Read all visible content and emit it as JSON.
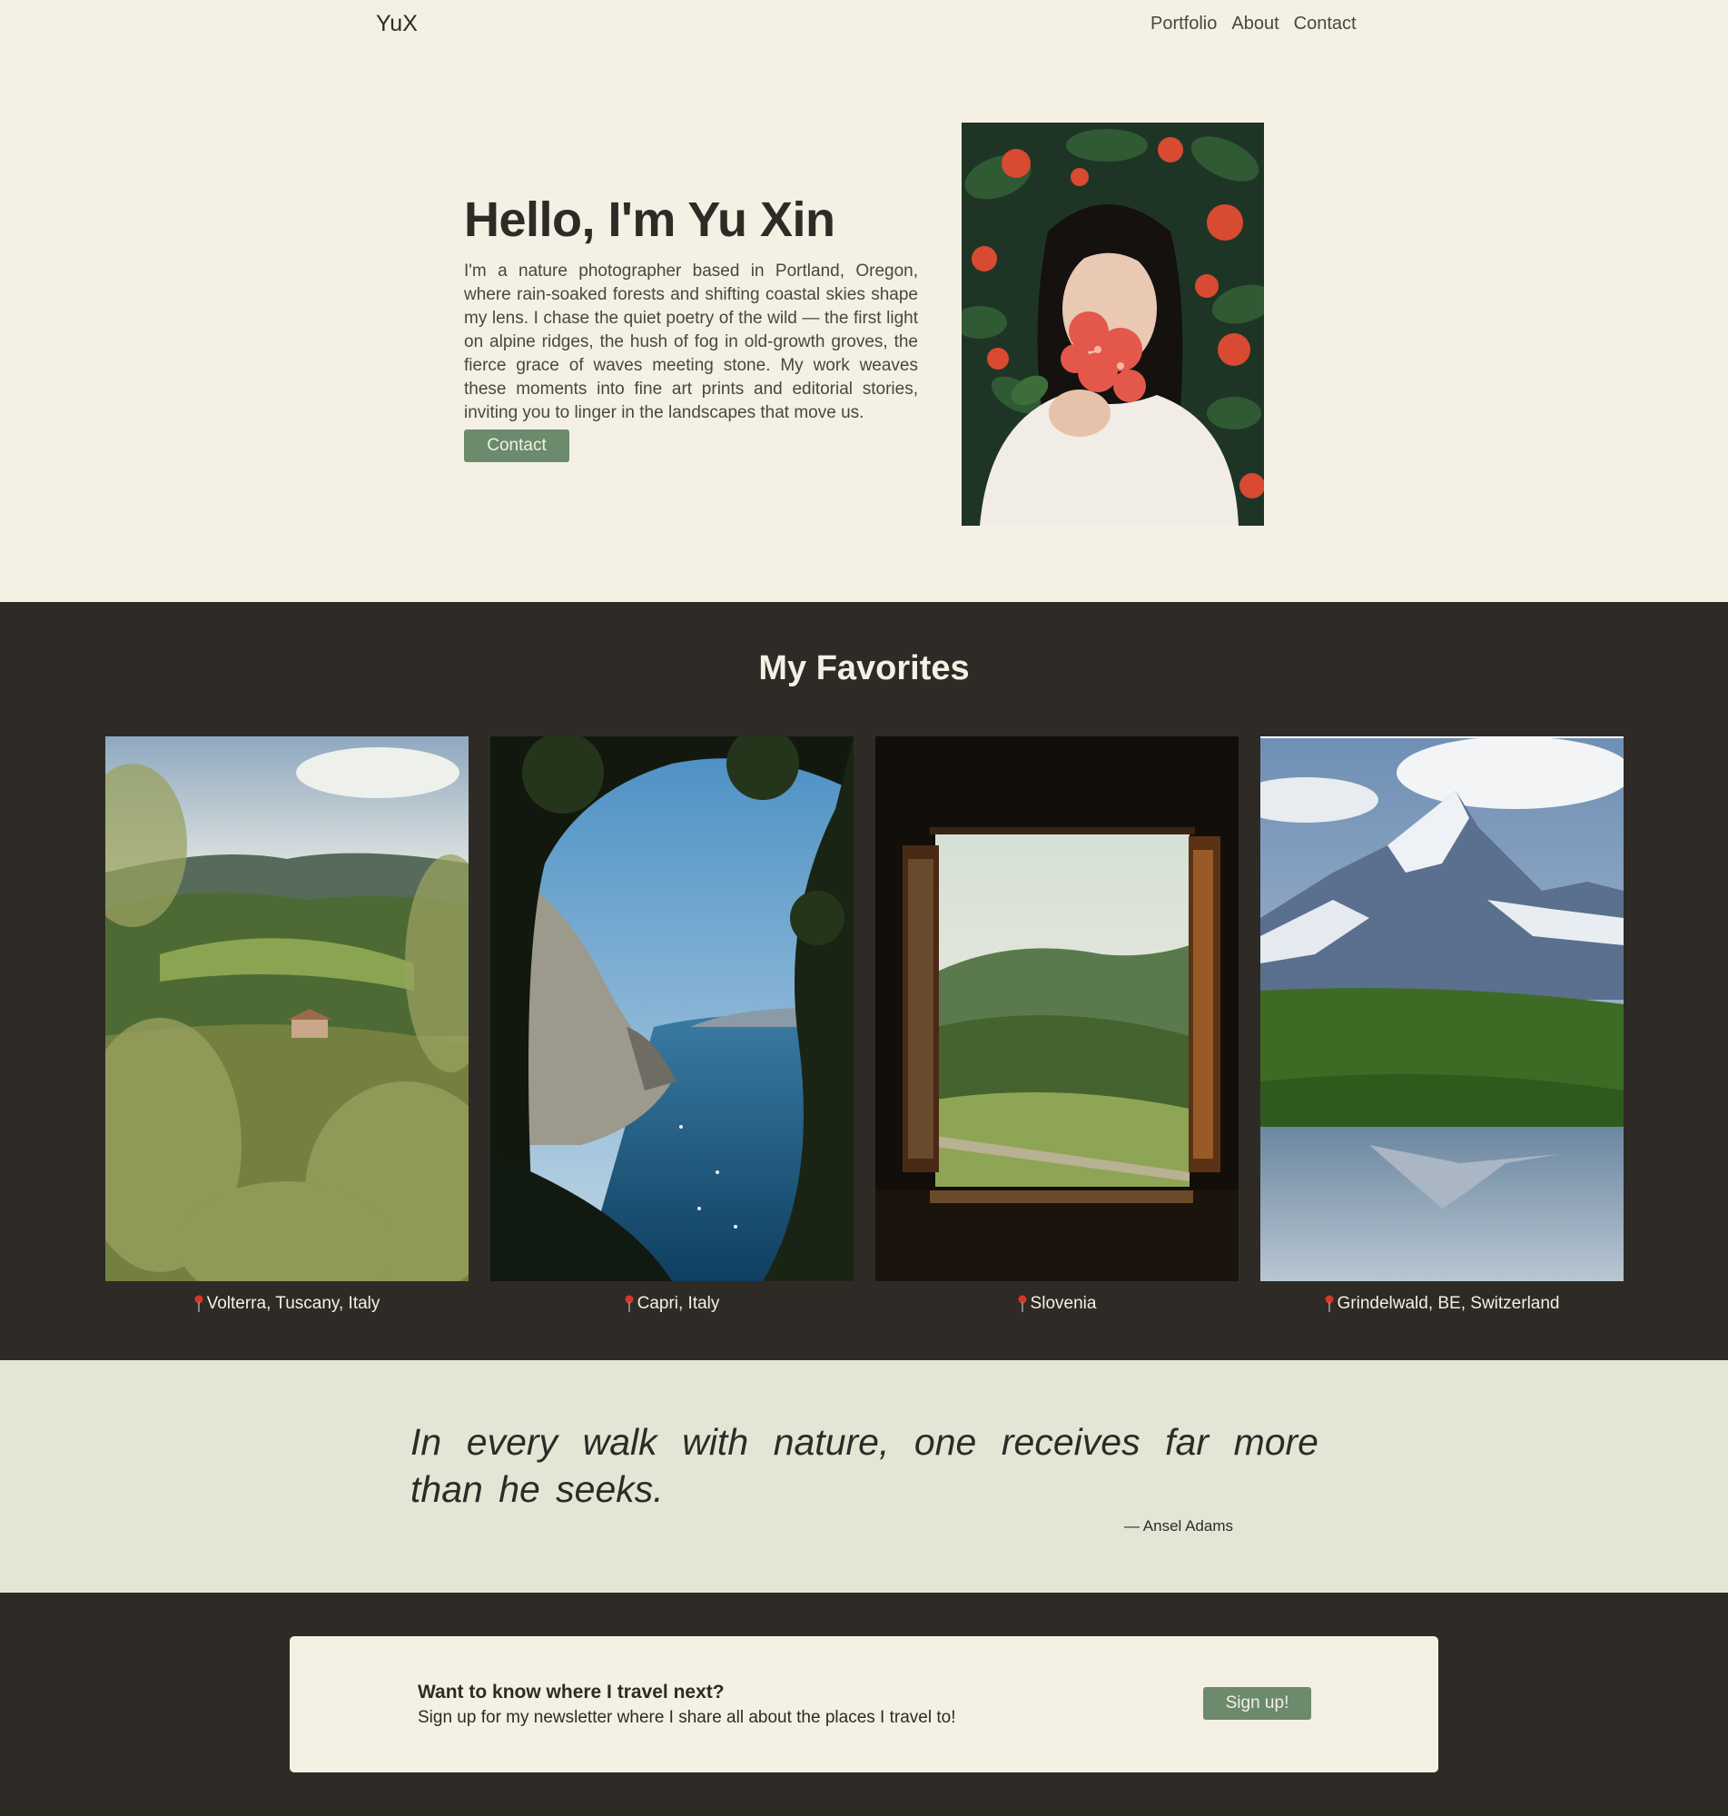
{
  "nav": {
    "brand": "YuX",
    "links": [
      "Portfolio",
      "About",
      "Contact"
    ]
  },
  "hero": {
    "title": "Hello, I'm Yu Xin",
    "text": "I'm a nature photographer based in Portland, Oregon, where rain-soaked forests and shifting coastal skies shape my lens. I chase the quiet poetry of the wild — the first light on alpine ridges, the hush of fog in old-growth groves, the fierce grace of waves meeting stone. My work weaves these moments into fine art prints and editorial stories, inviting you to linger in the landscapes that move us.",
    "button": "Contact"
  },
  "favorites": {
    "title": "My Favorites",
    "items": [
      {
        "caption": "Volterra, Tuscany, Italy"
      },
      {
        "caption": "Capri, Italy"
      },
      {
        "caption": "Slovenia"
      },
      {
        "caption": "Grindelwald, BE, Switzerland"
      }
    ]
  },
  "quote": {
    "text": "In every walk with nature, one receives far more than he seeks.",
    "author": "— Ansel Adams"
  },
  "newsletter": {
    "title": "Want to know where I travel next?",
    "text": "Sign up for my newsletter where I share all about the places I travel to!",
    "button": "Sign up!"
  },
  "colors": {
    "cream": "#f4f0e4",
    "dark": "#2e2b27",
    "accent_green": "#6b8b6c",
    "quote_bg": "#e4e6d5",
    "pin_red": "#d9352a"
  }
}
